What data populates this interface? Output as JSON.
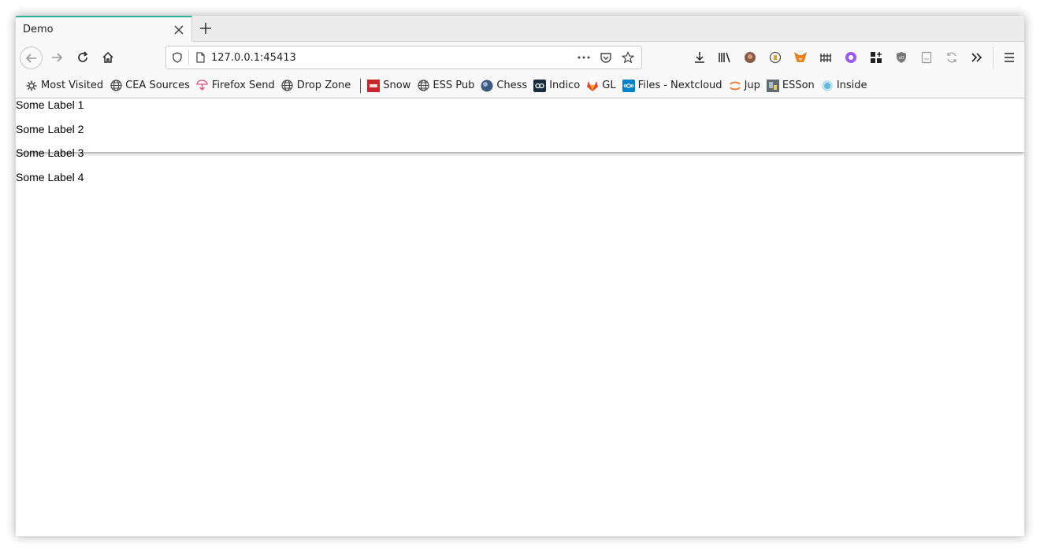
{
  "tab": {
    "title": "Demo"
  },
  "urlbar": {
    "url": "127.0.0.1:45413"
  },
  "bookmarks": [
    {
      "label": "Most Visited",
      "icon": "gear-icon"
    },
    {
      "label": "CEA Sources",
      "icon": "globe-icon"
    },
    {
      "label": "Firefox Send",
      "icon": "send-icon"
    },
    {
      "label": "Drop Zone",
      "icon": "globe-icon"
    },
    {
      "label": "Snow",
      "icon": "now-icon"
    },
    {
      "label": "ESS Pub",
      "icon": "globe-icon"
    },
    {
      "label": "Chess",
      "icon": "chess-icon"
    },
    {
      "label": "Indico",
      "icon": "indico-icon"
    },
    {
      "label": "GL",
      "icon": "gitlab-icon"
    },
    {
      "label": "Files - Nextcloud",
      "icon": "nextcloud-icon"
    },
    {
      "label": "Jup",
      "icon": "jupyter-icon"
    },
    {
      "label": "ESSon",
      "icon": "ess-icon"
    },
    {
      "label": "Inside",
      "icon": "inside-icon"
    }
  ],
  "content": {
    "labels": [
      "Some Label 1",
      "Some Label 2",
      "Some Label 3",
      "Some Label 4"
    ]
  },
  "colors": {
    "tab_accent": "#2ab29b",
    "chrome_bg": "#f9f9fa",
    "tabstrip_bg": "#ececec"
  }
}
